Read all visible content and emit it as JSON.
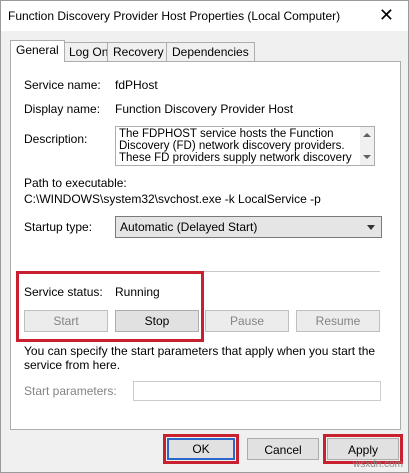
{
  "window": {
    "title": "Function Discovery Provider Host Properties (Local Computer)",
    "close_glyph": "✕"
  },
  "tabs": [
    {
      "label": "General",
      "active": true
    },
    {
      "label": "Log On",
      "active": false
    },
    {
      "label": "Recovery",
      "active": false
    },
    {
      "label": "Dependencies",
      "active": false
    }
  ],
  "general": {
    "service_name_label": "Service name:",
    "service_name_value": "fdPHost",
    "display_name_label": "Display name:",
    "display_name_value": "Function Discovery Provider Host",
    "description_label": "Description:",
    "description_value": "The FDPHOST service hosts the Function Discovery (FD) network discovery providers. These FD providers supply network discovery services for",
    "path_label": "Path to executable:",
    "path_value": "C:\\WINDOWS\\system32\\svchost.exe -k LocalService -p",
    "startup_type_label": "Startup type:",
    "startup_type_value": "Automatic (Delayed Start)",
    "service_status_label": "Service status:",
    "service_status_value": "Running",
    "buttons": {
      "start": "Start",
      "stop": "Stop",
      "pause": "Pause",
      "resume": "Resume"
    },
    "start_params_info": "You can specify the start parameters that apply when you start the service from here.",
    "start_params_label": "Start parameters:",
    "start_params_value": ""
  },
  "footer": {
    "ok": "OK",
    "cancel": "Cancel",
    "apply": "Apply"
  },
  "watermark": "wsxdn.com",
  "colors": {
    "highlight_box": "#c8202f",
    "ok_focus_border": "#2b67c9"
  }
}
